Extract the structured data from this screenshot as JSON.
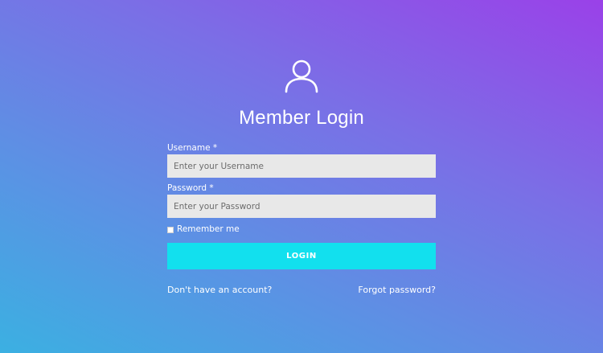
{
  "header": {
    "icon": "user-icon",
    "title": "Member Login"
  },
  "form": {
    "username": {
      "label": "Username *",
      "placeholder": "Enter your Username",
      "value": ""
    },
    "password": {
      "label": "Password *",
      "placeholder": "Enter your Password",
      "value": ""
    },
    "remember": {
      "label": "Remember me",
      "checked": false
    },
    "submit_label": "LOGIN"
  },
  "links": {
    "signup": "Don't have an account?",
    "forgot": "Forgot password?"
  },
  "colors": {
    "gradient_start": "#3bb0e2",
    "gradient_end": "#9a41e8",
    "button": "#12e0ee",
    "input_bg": "#e8e8e8"
  }
}
